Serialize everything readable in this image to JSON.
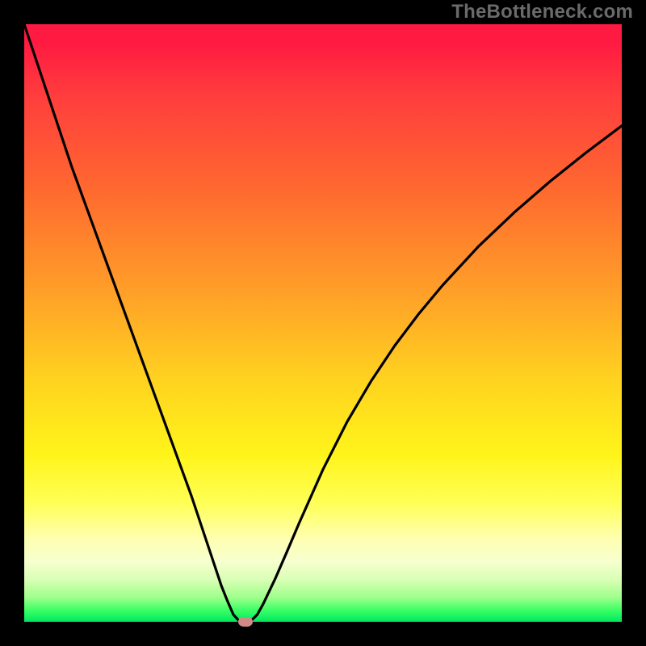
{
  "watermark": "TheBottleneck.com",
  "chart_data": {
    "type": "line",
    "title": "",
    "xlabel": "",
    "ylabel": "",
    "xlim": [
      0,
      100
    ],
    "ylim": [
      0,
      100
    ],
    "grid": false,
    "legend": false,
    "background_gradient": {
      "orientation": "vertical",
      "stops": [
        {
          "pos": 0.0,
          "color": "#ff1a42"
        },
        {
          "pos": 0.28,
          "color": "#ff6a2f"
        },
        {
          "pos": 0.6,
          "color": "#ffd41f"
        },
        {
          "pos": 0.86,
          "color": "#ffffb0"
        },
        {
          "pos": 1.0,
          "color": "#00e85f"
        }
      ]
    },
    "series": [
      {
        "name": "bottleneck-curve",
        "color": "#000000",
        "x": [
          0,
          2,
          4,
          6,
          8,
          10,
          12,
          14,
          16,
          18,
          20,
          22,
          24,
          26,
          28,
          30,
          32,
          33,
          34,
          35,
          36,
          37,
          38,
          39,
          40,
          42,
          44,
          46,
          48,
          50,
          54,
          58,
          62,
          66,
          70,
          76,
          82,
          88,
          94,
          100
        ],
        "y": [
          100,
          94,
          88,
          82,
          76,
          70.5,
          65,
          59.5,
          54,
          48.5,
          43,
          37.5,
          32,
          26.5,
          21,
          15,
          9,
          6,
          3.5,
          1.2,
          0.1,
          0.0,
          0.2,
          1.2,
          3.0,
          7.2,
          11.8,
          16.5,
          21.0,
          25.5,
          33.4,
          40.2,
          46.2,
          51.5,
          56.3,
          62.8,
          68.5,
          73.7,
          78.5,
          83.0
        ]
      }
    ],
    "marker": {
      "x": 37.0,
      "y": 0.0,
      "color": "#d28a87"
    }
  }
}
